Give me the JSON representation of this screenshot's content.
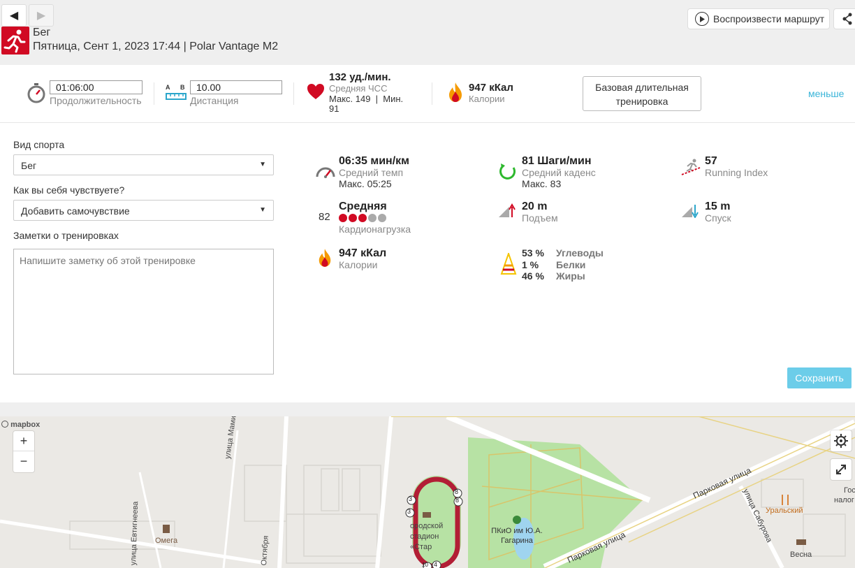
{
  "nav": {
    "back_icon": "◀",
    "forward_icon": "▶"
  },
  "header": {
    "sport": "Бег",
    "subtitle": "Пятница, Сент 1, 2023 17:44 | Polar Vantage M2",
    "replay_label": "Воспроизвести маршрут"
  },
  "summary": {
    "duration_value": "01:06:00",
    "duration_label": "Продолжительность",
    "distance_a": "A",
    "distance_b": "B",
    "distance_value": "10.00",
    "distance_label": "Дистанция",
    "hr_value": "132 уд./мин.",
    "hr_label": "Средняя ЧСС",
    "hr_minmax_1": "Макс. 149  |  Мин.",
    "hr_minmax_2": "91",
    "calories_value": "947 кКал",
    "calories_label": "Калории",
    "training_type_line1": "Базовая длительная",
    "training_type_line2": "тренировка",
    "less_label": "меньше"
  },
  "form": {
    "sport_label": "Вид спорта",
    "sport_value": "Бег",
    "feeling_label": "Как вы себя чувствуете?",
    "feeling_value": "Добавить самочувствие",
    "notes_label": "Заметки о тренировках",
    "notes_placeholder": "Напишите заметку об этой тренировке",
    "save_label": "Сохранить"
  },
  "stats": {
    "pace_value": "06:35 мин/км",
    "pace_label": "Средний темп",
    "pace_max": "Макс. 05:25",
    "cadence_value": "81 Шаги/мин",
    "cadence_label": "Средний каденс",
    "cadence_max": "Макс. 83",
    "running_index_value": "57",
    "running_index_label": "Running Index",
    "cardio_number": "82",
    "cardio_value": "Средняя",
    "cardio_label": "Кардионагрузка",
    "cardio_dots_filled": 3,
    "cardio_dots_total": 5,
    "ascent_value": "20 m",
    "ascent_label": "Подъем",
    "descent_value": "15 m",
    "descent_label": "Спуск",
    "calories_value": "947 кКал",
    "calories_label": "Калории",
    "carbs_pct": "53 %",
    "carbs_label": "Углеводы",
    "protein_pct": "1 %",
    "protein_label": "Белки",
    "fat_pct": "46 %",
    "fat_label": "Жиры"
  },
  "map": {
    "attribution": "mapbox",
    "zoom_in": "+",
    "zoom_out": "−",
    "labels": {
      "street_mamina": "улица Мамина-Сибиряка",
      "street_evtikheeva": "улица Евтигнеева",
      "street_oktyabrya": "Октября",
      "omega": "Омега",
      "stadium": "ородской стадион «Стар",
      "park": "ПКиО им Ю.А. Гагарина",
      "parkovaya_1": "Парковая улица",
      "parkovaya_2": "Парковая улица",
      "sabourova": "улица Сабурова",
      "uralsky": "Уральский",
      "vesna": "Весна",
      "gos": "Гос",
      "nalog": "налог"
    },
    "route_markers": [
      "3",
      "3",
      "8",
      "8",
      "10",
      "4"
    ]
  },
  "colors": {
    "brand_red": "#d10a23",
    "link_blue": "#39b4d8",
    "save_bg": "#6ccde9",
    "dot_red": "#d10a23",
    "dot_gray": "#aaaaaa"
  }
}
